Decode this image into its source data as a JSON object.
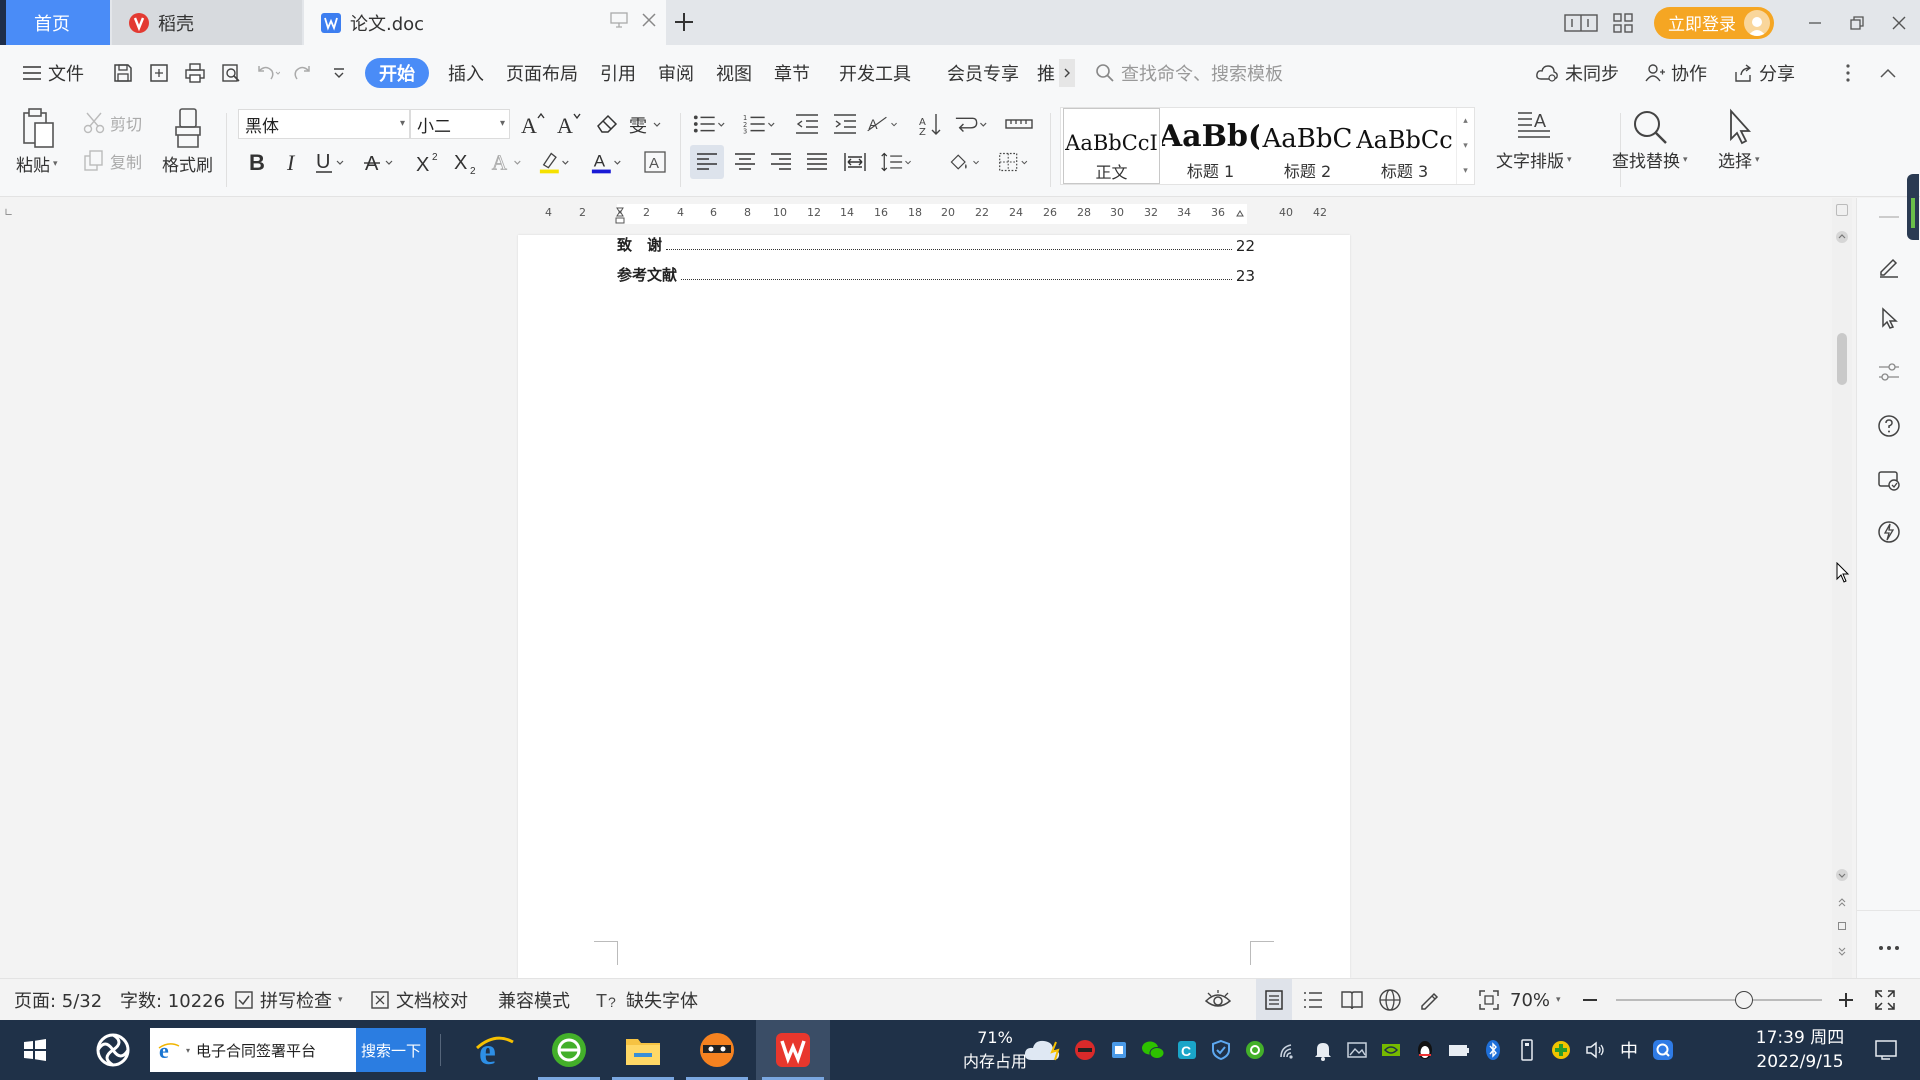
{
  "tabs": {
    "home": "首页",
    "daoke": "稻壳",
    "doc": "论文.doc"
  },
  "titlebar": {
    "login": "立即登录"
  },
  "menu": {
    "file": "文件",
    "items": [
      "开始",
      "插入",
      "页面布局",
      "引用",
      "审阅",
      "视图",
      "章节",
      "开发工具",
      "会员专享",
      "推"
    ],
    "search_placeholder": "查找命令、搜索模板",
    "sync": "未同步",
    "collab": "协作",
    "share": "分享"
  },
  "ribbon": {
    "paste": "粘贴",
    "cut": "剪切",
    "copy": "复制",
    "format_painter": "格式刷",
    "font_name": "黑体",
    "font_size": "小二",
    "styles": [
      {
        "sample": "AaBbCcI",
        "name": "正文"
      },
      {
        "sample": "AaBb(",
        "name": "标题 1"
      },
      {
        "sample": "AaBbC",
        "name": "标题 2"
      },
      {
        "sample": "AaBbCc",
        "name": "标题 3"
      }
    ],
    "text_layout": "文字排版",
    "find_replace": "查找替换",
    "select": "选择"
  },
  "ruler": {
    "ticks": [
      "4",
      "2",
      "2",
      "4",
      "6",
      "8",
      "10",
      "12",
      "14",
      "16",
      "18",
      "20",
      "22",
      "24",
      "26",
      "28",
      "30",
      "32",
      "34",
      "36",
      "40",
      "42"
    ]
  },
  "document": {
    "toc": [
      {
        "title": "致　谢",
        "page": "22"
      },
      {
        "title": "参考文献",
        "page": "23"
      }
    ]
  },
  "status": {
    "page": "页面: 5/32",
    "words": "字数: 10226",
    "spell": "拼写检查",
    "proof": "文档校对",
    "compat": "兼容模式",
    "missing_font": "缺失字体",
    "zoom": "70%",
    "zoom_level": 0.62
  },
  "taskbar": {
    "search_text": "电子合同签署平台",
    "search_button": "搜索一下",
    "memory_percent": "71%",
    "memory_label": "内存占用",
    "ime": "中",
    "time": "17:39 周四",
    "date": "2022/9/15"
  }
}
